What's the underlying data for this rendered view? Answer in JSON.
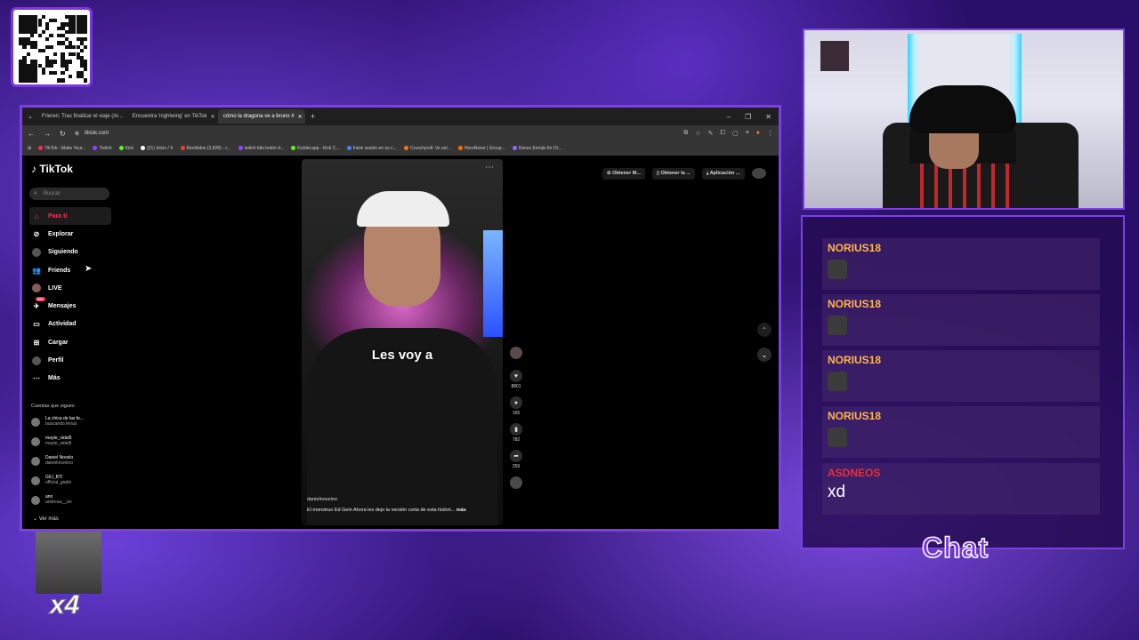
{
  "browser": {
    "tabs": [
      {
        "label": "Frieren: Tras finalizar el viaje (Ar...",
        "active": false
      },
      {
        "label": "Encuentra 'nightwing' en TikTok",
        "active": false
      },
      {
        "label": "cómo la dragona ve a bruno #",
        "active": true
      }
    ],
    "url": "tiktok.com",
    "bookmarks": [
      "TikTok - Make Your...",
      "Twitch",
      "Kick",
      "(21) Inicio / X",
      "Recibidos (3,828) - c...",
      "twitch bits botón d...",
      "Kicklet.app - Kick C...",
      "Inicie sesión en su c...",
      "Crunchyroll: Ve así...",
      "HeroNoise | Group...",
      "Dance Emojis for Di..."
    ]
  },
  "tiktok": {
    "logo": "TikTok",
    "search_placeholder": "Buscar",
    "nav": [
      "Para ti",
      "Explorar",
      "Siguiendo",
      "Friends",
      "LIVE",
      "Mensajes",
      "Actividad",
      "Cargar",
      "Perfil",
      "Más"
    ],
    "messages_badge": "99+",
    "following_title": "Cuentas que sigues",
    "accounts": [
      {
        "name": "La chica de las fe...",
        "handle": "buscando.ferias"
      },
      {
        "name": "mayte_vidal9",
        "handle": "mayte_vidal9"
      },
      {
        "name": "Daniel Novelo",
        "handle": "danielnoveloo"
      },
      {
        "name": "GIU_BTI",
        "handle": "official_giubti"
      },
      {
        "name": "ann",
        "handle": "andreaa__an"
      }
    ],
    "see_more": "Ver más",
    "top_buttons": [
      "Obtener M...",
      "Obtener la ...",
      "Aplicación ..."
    ],
    "video": {
      "caption": "Les voy a",
      "username": "danielnoveloo",
      "description": "El monstruo Ed Gein  Ahora les dejo la versión corta de esta histori...",
      "more": "más",
      "likes": "8801",
      "comments": "165",
      "saves": "782",
      "shares": "259"
    }
  },
  "chat": {
    "messages": [
      {
        "user": "NORIUS18",
        "type": "emote"
      },
      {
        "user": "NORIUS18",
        "type": "emote"
      },
      {
        "user": "NORIUS18",
        "type": "emote"
      },
      {
        "user": "NORIUS18",
        "type": "emote"
      },
      {
        "user": "ASDNEOS",
        "type": "text",
        "text": "xd"
      }
    ],
    "label": "Chat"
  },
  "overlay": {
    "sub_multiplier": "x4"
  },
  "colors": {
    "accent": "#7b3fe4",
    "tiktok_red": "#fe2c55",
    "chat_user": "#ffb548",
    "chat_user_alt": "#e0313b"
  }
}
